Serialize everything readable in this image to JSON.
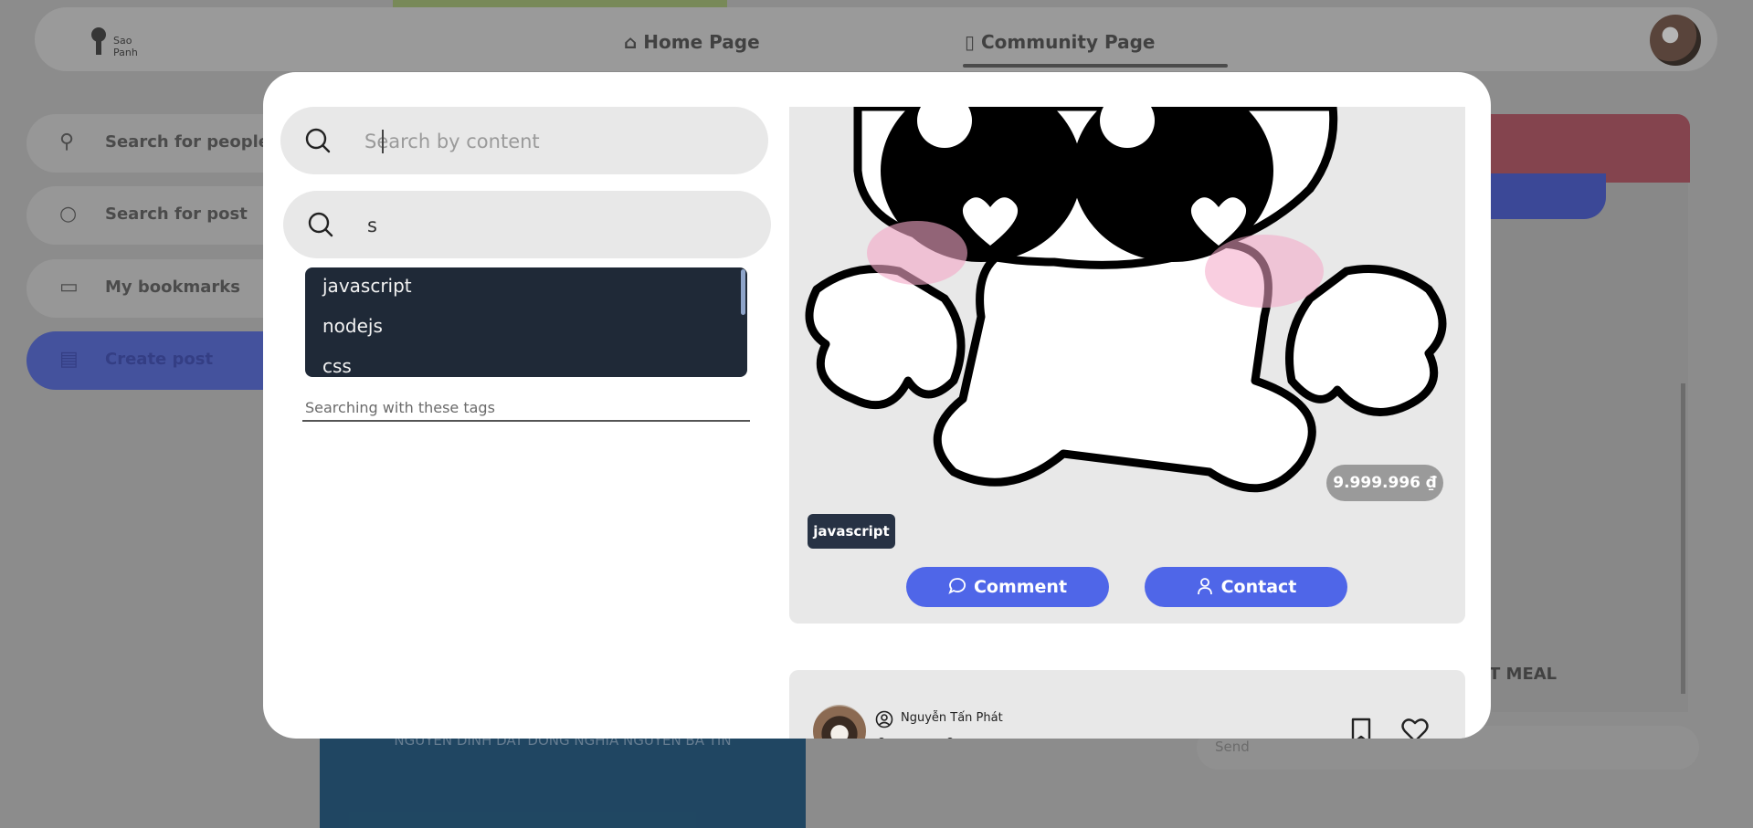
{
  "app": {
    "logo_text": "Sao Panh",
    "nav": {
      "home_label": "Home Page",
      "community_label": "Community Page"
    }
  },
  "sidebar": {
    "items": [
      {
        "label": "Search for people",
        "icon": "person-icon"
      },
      {
        "label": "Search for post",
        "icon": "search-icon"
      },
      {
        "label": "My bookmarks",
        "icon": "bookmark-icon"
      },
      {
        "label": "Create post",
        "icon": "document-icon"
      }
    ]
  },
  "background": {
    "right_panel_text": "T MEAL",
    "send_placeholder": "Send",
    "blue_card_text": "NGUYEN DINH DAT DONG NGHIA NGUYEN BA TIN"
  },
  "modal": {
    "search_content": {
      "placeholder": "Search by content",
      "value": ""
    },
    "search_tags": {
      "value": "s"
    },
    "tag_suggestions": [
      "javascript",
      "nodejs",
      "css"
    ],
    "tags_label": "Searching with these tags",
    "post": {
      "price": "9.999.996 ₫",
      "tag": "javascript",
      "comment_label": "Comment",
      "contact_label": "Contact"
    },
    "next_post": {
      "author_name": "Nguyễn Tấn Phát"
    }
  },
  "colors": {
    "accent_blue": "#4f66e8",
    "dropdown_bg": "#1f2937",
    "tag_bg": "#273244",
    "card_bg": "#e8e8e8",
    "price_badge": "#9a9a9a"
  }
}
